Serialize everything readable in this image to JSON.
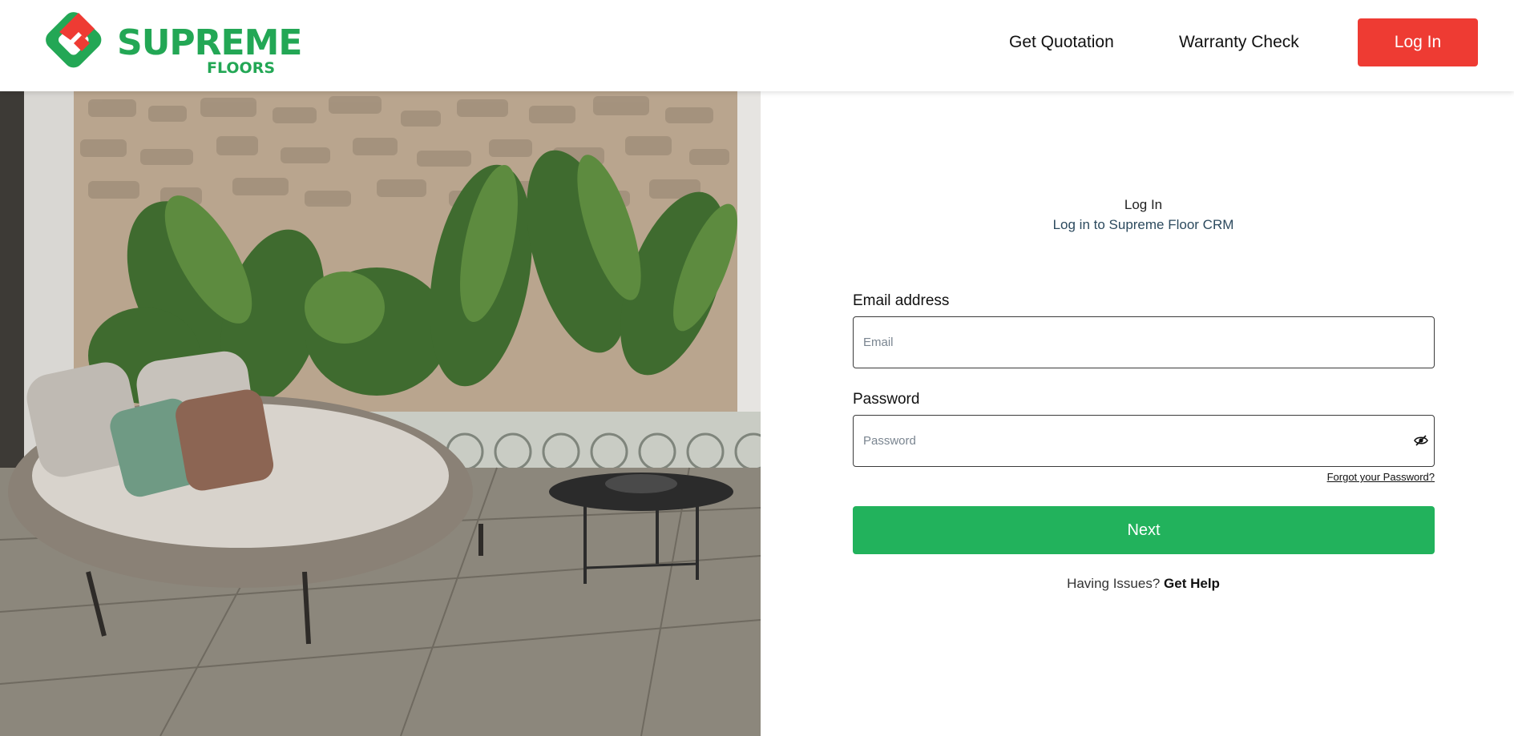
{
  "header": {
    "logo": {
      "word1": "SUPREME",
      "word2": "FLOORS",
      "brand_green": "#23a755",
      "brand_red": "#ee3b33"
    },
    "nav": {
      "get_quotation": "Get Quotation",
      "warranty_check": "Warranty Check"
    },
    "login_button": "Log In"
  },
  "hero": {
    "icon": "outdoor-lounge-scene-image"
  },
  "form": {
    "title": "Log In",
    "subtitle": "Log in to Supreme Floor CRM",
    "email_label": "Email address",
    "email_placeholder": "Email",
    "email_value": "",
    "password_label": "Password",
    "password_placeholder": "Password",
    "password_value": "",
    "toggle_icon": "eye-slash-icon",
    "forgot_password": "Forgot your Password?",
    "next_button": "Next",
    "help_prefix": "Having Issues?",
    "help_link": "Get Help",
    "accent_green": "#22b25c"
  }
}
